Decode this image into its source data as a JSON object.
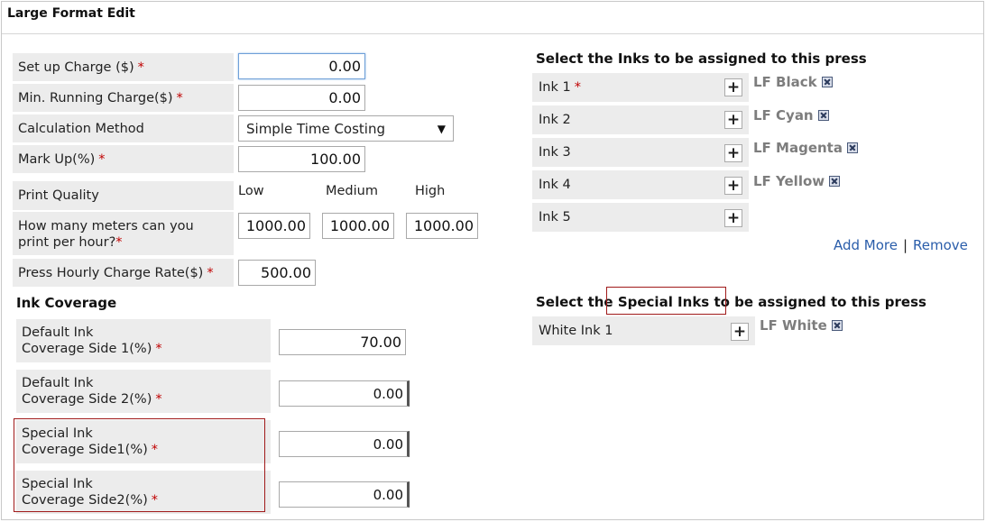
{
  "window": {
    "title": "Large Format Edit"
  },
  "form": {
    "setup_charge": {
      "label": "Set up Charge ($)",
      "required": "*",
      "value": "0.00"
    },
    "min_running_charge": {
      "label": "Min. Running Charge($)",
      "required": "*",
      "value": "0.00"
    },
    "calculation_method": {
      "label": "Calculation Method",
      "value": "Simple Time Costing"
    },
    "mark_up": {
      "label": "Mark Up(%)",
      "required": "*",
      "value": "100.00"
    },
    "print_quality": {
      "label": "Print Quality",
      "columns": [
        "Low",
        "Medium",
        "High"
      ]
    },
    "meters_per_hour": {
      "label_line1": "How many meters can you",
      "label_line2": "print per hour?",
      "required": "*",
      "values": [
        "1000.00",
        "1000.00",
        "1000.00"
      ]
    },
    "hourly_rate": {
      "label": "Press Hourly Charge Rate($)",
      "required": "*",
      "value": "500.00"
    }
  },
  "ink_coverage": {
    "heading": "Ink Coverage",
    "rows": [
      {
        "line1": "Default Ink",
        "line2": "Coverage Side 1(%)",
        "required": "*",
        "value": "70.00"
      },
      {
        "line1": "Default Ink",
        "line2": "Coverage Side 2(%)",
        "required": "*",
        "value": "0.00"
      },
      {
        "line1": "Special Ink",
        "line2": "Coverage Side1(%)",
        "required": "*",
        "value": "0.00"
      },
      {
        "line1": "Special Ink",
        "line2": "Coverage Side2(%)",
        "required": "*",
        "value": "0.00"
      }
    ]
  },
  "inks": {
    "heading": "Select the Inks to be assigned to this press",
    "slots": [
      {
        "label": "Ink 1",
        "required": "*",
        "assigned": "LF Black"
      },
      {
        "label": "Ink 2",
        "required": "",
        "assigned": "LF Cyan"
      },
      {
        "label": "Ink 3",
        "required": "",
        "assigned": "LF Magenta"
      },
      {
        "label": "Ink 4",
        "required": "",
        "assigned": "LF Yellow"
      },
      {
        "label": "Ink 5",
        "required": "",
        "assigned": ""
      }
    ],
    "add_more": "Add More",
    "separator": "|",
    "remove": "Remove"
  },
  "special_inks": {
    "heading_pre": "Select the ",
    "heading_mid": "Special Inks",
    "heading_post": " to be assigned to this press",
    "slots": [
      {
        "label": "White Ink 1",
        "assigned": "LF White"
      }
    ]
  },
  "colors": {
    "required": "#c00000",
    "link": "#2a5daa",
    "assigned_ink": "#7d7d7d",
    "highlight_box": "#a01a1a"
  },
  "icons": {
    "add": "plus-icon",
    "remove_ink": "close-box-icon",
    "dropdown": "caret-down-icon"
  }
}
